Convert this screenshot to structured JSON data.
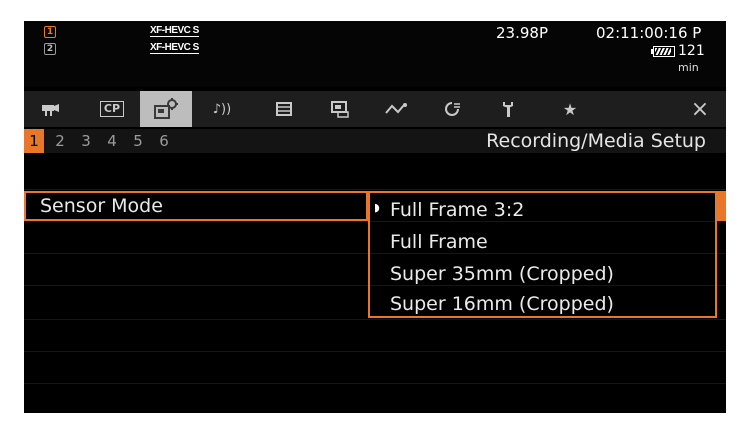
{
  "status": {
    "slot_a_label": "1",
    "slot_b_label": "2",
    "codec_a": "XF-HEVC S",
    "codec_b": "XF-HEVC S",
    "frame_rate": "23.98P",
    "timecode": "02:11:00:16 P",
    "battery_level": 0.9,
    "remaining_value": "121",
    "remaining_unit": "min"
  },
  "tabs": [
    {
      "name": "camera",
      "icon": "camera-icon"
    },
    {
      "name": "custom-picture",
      "icon": "cp-icon",
      "label": "CP"
    },
    {
      "name": "recording-media-setup",
      "icon": "recording-setup-icon",
      "active": true
    },
    {
      "name": "audio",
      "icon": "audio-icon",
      "label": "♪))"
    },
    {
      "name": "system",
      "icon": "monitor-icon"
    },
    {
      "name": "assistance",
      "icon": "assist-icon"
    },
    {
      "name": "network",
      "icon": "network-icon"
    },
    {
      "name": "custom",
      "icon": "custom-icon"
    },
    {
      "name": "maintenance",
      "icon": "wrench-icon"
    },
    {
      "name": "my-menu",
      "icon": "star-icon",
      "label": "★"
    },
    {
      "name": "close",
      "icon": "close-icon",
      "label": "×"
    }
  ],
  "pages": [
    "1",
    "2",
    "3",
    "4",
    "5",
    "6"
  ],
  "active_page": "1",
  "section_title": "Recording/Media Setup",
  "menu": {
    "item_label": "Sensor Mode",
    "selected_marker": "◗",
    "options": [
      "Full Frame 3:2",
      "Full Frame",
      "Super 35mm (Cropped)",
      "Super 16mm (Cropped)"
    ]
  },
  "colors": {
    "accent": "#e8772a",
    "background": "#000000",
    "tab_bar": "#1e1e1e",
    "active_tab": "#bdbdbd",
    "text": "#e8e8e8"
  }
}
